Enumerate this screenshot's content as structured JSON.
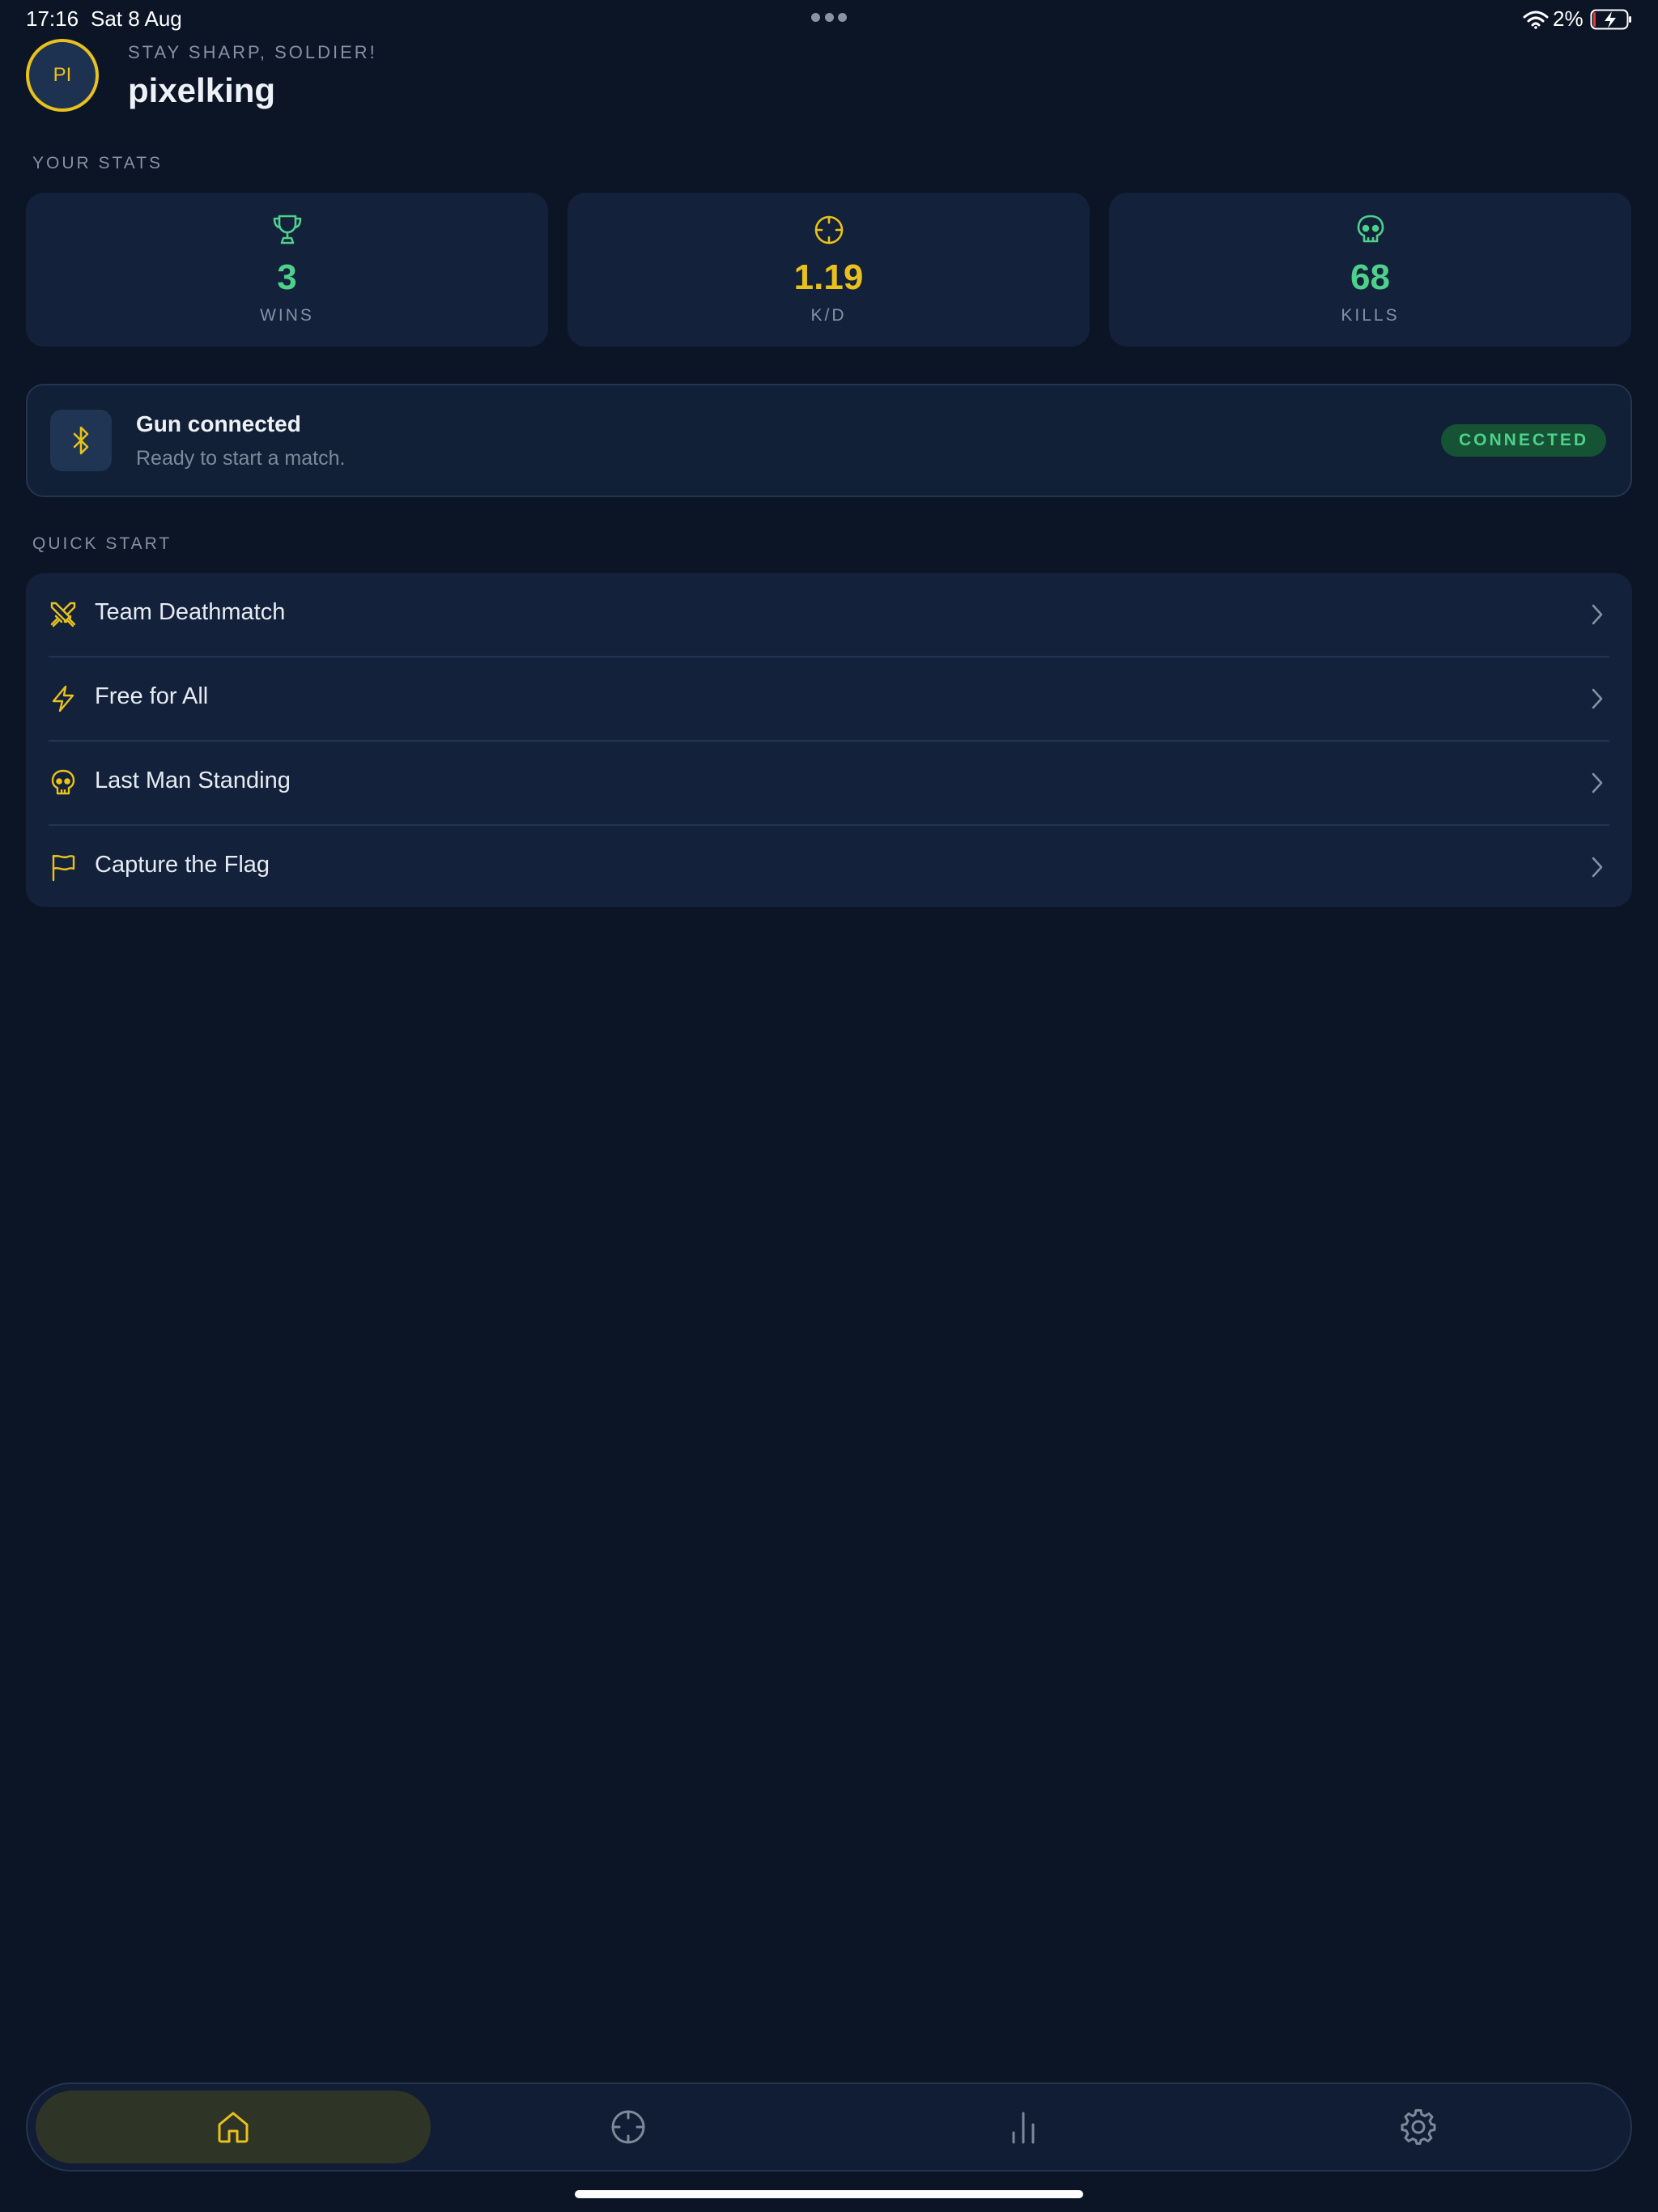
{
  "status_bar": {
    "time": "17:16",
    "date": "Sat 8 Aug",
    "battery_percent": "2%"
  },
  "header": {
    "avatar_initials": "PI",
    "greeting": "STAY SHARP, SOLDIER!",
    "username": "pixelking"
  },
  "stats": {
    "section_label": "YOUR STATS",
    "cards": [
      {
        "value": "3",
        "label": "WINS",
        "icon": "trophy-icon",
        "color": "#4ed08a"
      },
      {
        "value": "1.19",
        "label": "K/D",
        "icon": "crosshair-icon",
        "color": "#e8c11d"
      },
      {
        "value": "68",
        "label": "KILLS",
        "icon": "skull-icon",
        "color": "#4ed08a"
      }
    ]
  },
  "connection": {
    "title": "Gun connected",
    "subtitle": "Ready to start a match.",
    "badge": "CONNECTED",
    "icon": "bluetooth-icon"
  },
  "quick_start": {
    "section_label": "QUICK START",
    "items": [
      {
        "label": "Team Deathmatch",
        "icon": "crossed-swords-icon"
      },
      {
        "label": "Free for All",
        "icon": "lightning-icon"
      },
      {
        "label": "Last Man Standing",
        "icon": "skull-icon"
      },
      {
        "label": "Capture the Flag",
        "icon": "flag-icon"
      }
    ]
  },
  "tabbar": {
    "tabs": [
      {
        "name": "home",
        "icon": "home-icon",
        "active": true
      },
      {
        "name": "play",
        "icon": "crosshair-icon",
        "active": false
      },
      {
        "name": "stats",
        "icon": "bar-chart-icon",
        "active": false
      },
      {
        "name": "settings",
        "icon": "gear-icon",
        "active": false
      }
    ]
  },
  "colors": {
    "accent_yellow": "#e8c11d",
    "accent_green": "#4ed08a",
    "background": "#0b1526",
    "card": "#13213a"
  }
}
